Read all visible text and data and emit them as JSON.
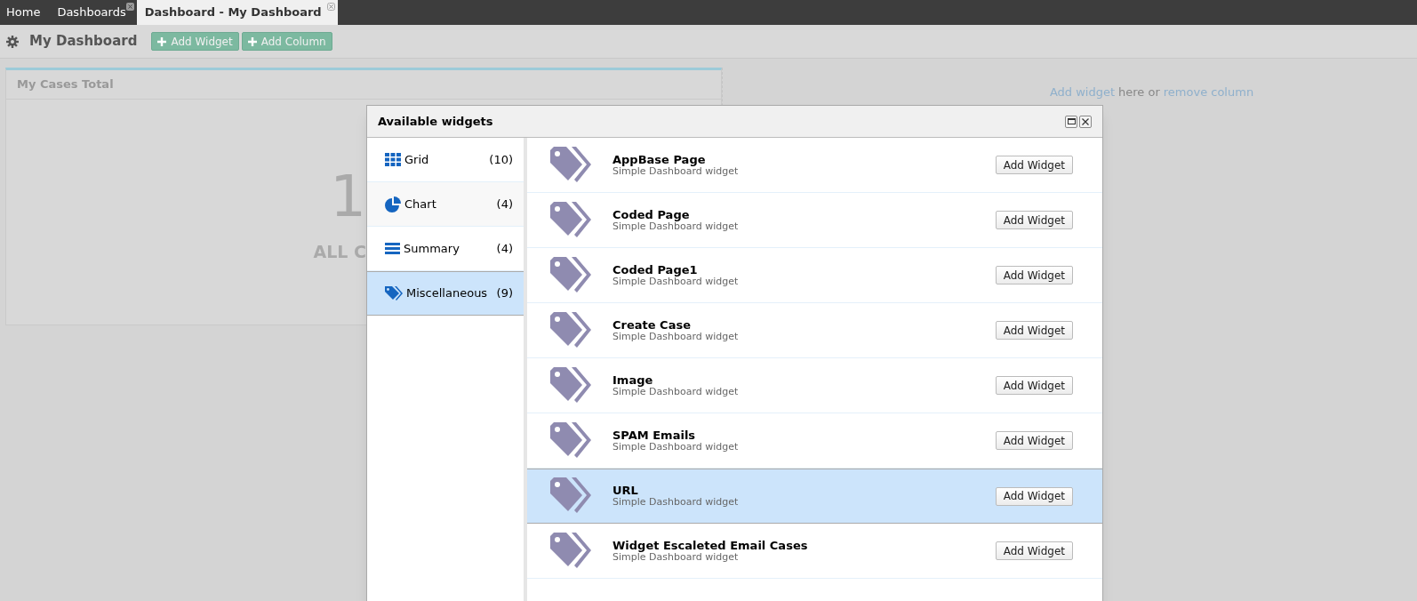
{
  "tabs": [
    {
      "label": "Home",
      "selected": false,
      "closable": false
    },
    {
      "label": "Dashboards",
      "selected": false,
      "closable": true
    },
    {
      "label": "Dashboard - My Dashboard",
      "selected": true,
      "closable": true
    }
  ],
  "toolbar": {
    "title": "My Dashboard",
    "buttons": [
      "Add Widget",
      "Add Column"
    ]
  },
  "widget": {
    "title": "My Cases Total",
    "value": "1",
    "caption": "ALL C"
  },
  "empty_column": {
    "link_add": "Add widget",
    "middle": "here or",
    "link_remove": "remove column"
  },
  "dialog": {
    "title": "Available widgets",
    "categories": [
      {
        "kind": "grid",
        "label": "Grid",
        "count": "(10)",
        "selected": false
      },
      {
        "kind": "chart",
        "label": "Chart",
        "count": "(4)",
        "selected": false
      },
      {
        "kind": "summary",
        "label": "Summary",
        "count": "(4)",
        "selected": false
      },
      {
        "kind": "tag",
        "label": "Miscellaneous",
        "count": "(9)",
        "selected": true
      }
    ],
    "widgets": [
      {
        "title": "AppBase Page",
        "subtitle": "Simple Dashboard widget",
        "button": "Add Widget",
        "selected": false
      },
      {
        "title": "Coded Page",
        "subtitle": "Simple Dashboard widget",
        "button": "Add Widget",
        "selected": false
      },
      {
        "title": "Coded Page1",
        "subtitle": "Simple Dashboard widget",
        "button": "Add Widget",
        "selected": false
      },
      {
        "title": "Create Case",
        "subtitle": "Simple Dashboard widget",
        "button": "Add Widget",
        "selected": false
      },
      {
        "title": "Image",
        "subtitle": "Simple Dashboard widget",
        "button": "Add Widget",
        "selected": false
      },
      {
        "title": "SPAM Emails",
        "subtitle": "Simple Dashboard widget",
        "button": "Add Widget",
        "selected": false
      },
      {
        "title": "URL",
        "subtitle": "Simple Dashboard widget",
        "button": "Add Widget",
        "selected": true
      },
      {
        "title": "Widget Escaleted Email Cases",
        "subtitle": "Simple Dashboard widget",
        "button": "Add Widget",
        "selected": false
      }
    ]
  }
}
